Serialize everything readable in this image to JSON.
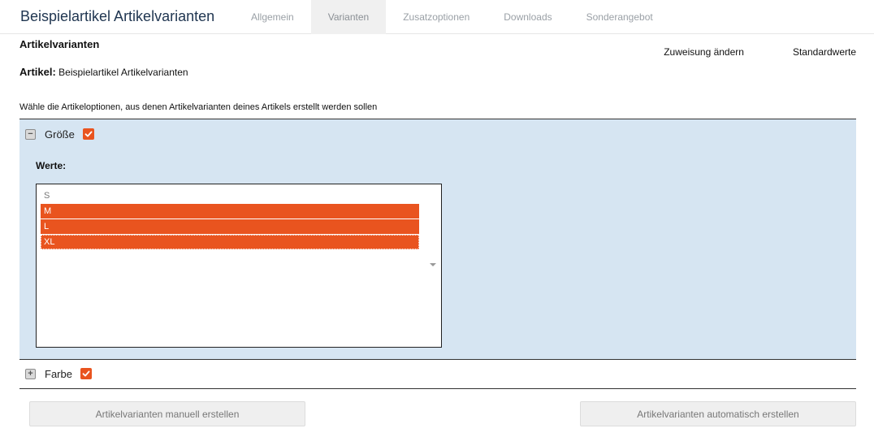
{
  "header": {
    "title": "Beispielartikel Artikelvarianten",
    "tabs": [
      {
        "label": "Allgemein",
        "active": false
      },
      {
        "label": "Varianten",
        "active": true
      },
      {
        "label": "Zusatzoptionen",
        "active": false
      },
      {
        "label": "Downloads",
        "active": false
      },
      {
        "label": "Sonderangebot",
        "active": false
      }
    ]
  },
  "section": {
    "title": "Artikelvarianten",
    "actions": {
      "change_assignment": "Zuweisung ändern",
      "defaults": "Standardwerte"
    },
    "article_label": "Artikel:",
    "article_name": "Beispielartikel Artikelvarianten",
    "instruction": "Wähle die Artikeloptionen, aus denen Artikelvarianten deines Artikels erstellt werden sollen"
  },
  "options": [
    {
      "name": "Größe",
      "expanded": true,
      "checked": true,
      "values_label": "Werte:",
      "values": [
        {
          "label": "S",
          "selected": false
        },
        {
          "label": "M",
          "selected": true
        },
        {
          "label": "L",
          "selected": true
        },
        {
          "label": "XL",
          "selected": true
        }
      ]
    },
    {
      "name": "Farbe",
      "expanded": false,
      "checked": true
    }
  ],
  "buttons": {
    "manual": "Artikelvarianten manuell erstellen",
    "auto": "Artikelvarianten automatisch erstellen"
  },
  "colors": {
    "accent": "#e9541f",
    "panel_bg": "#d6e5f2",
    "title": "#1f3550"
  }
}
